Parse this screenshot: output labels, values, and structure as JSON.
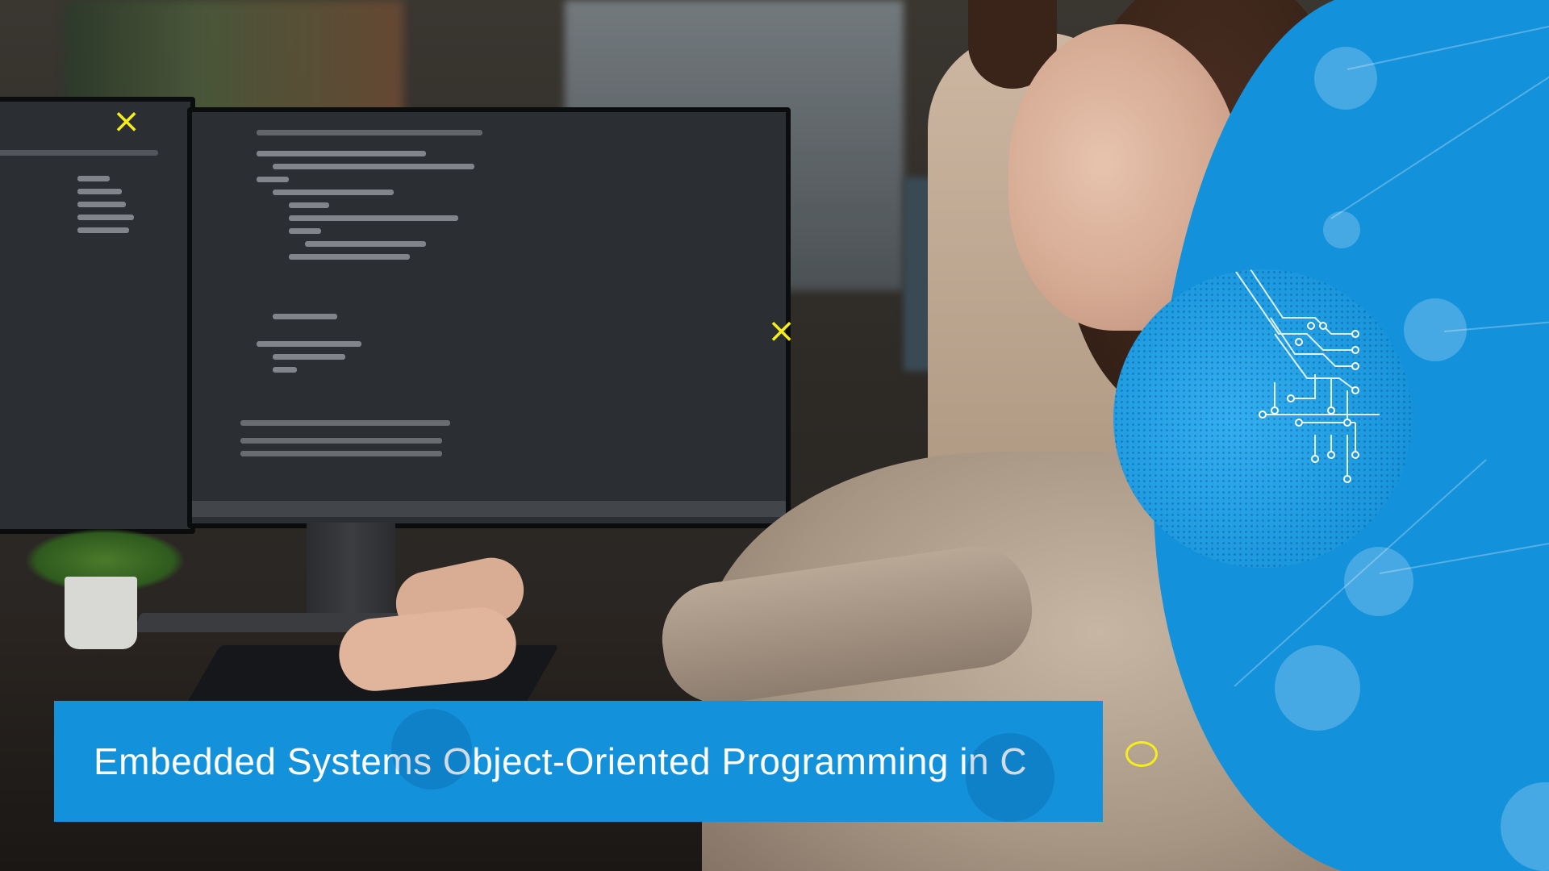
{
  "title": {
    "text": "Embedded Systems Object-Oriented Programming in C"
  },
  "colors": {
    "brand_blue": "#1391db",
    "accent_yellow": "#f5ee1a",
    "title_text": "#ffffff"
  },
  "decorations": {
    "cross_mark": "×",
    "circuit_icon": "circuit-board-icon"
  }
}
